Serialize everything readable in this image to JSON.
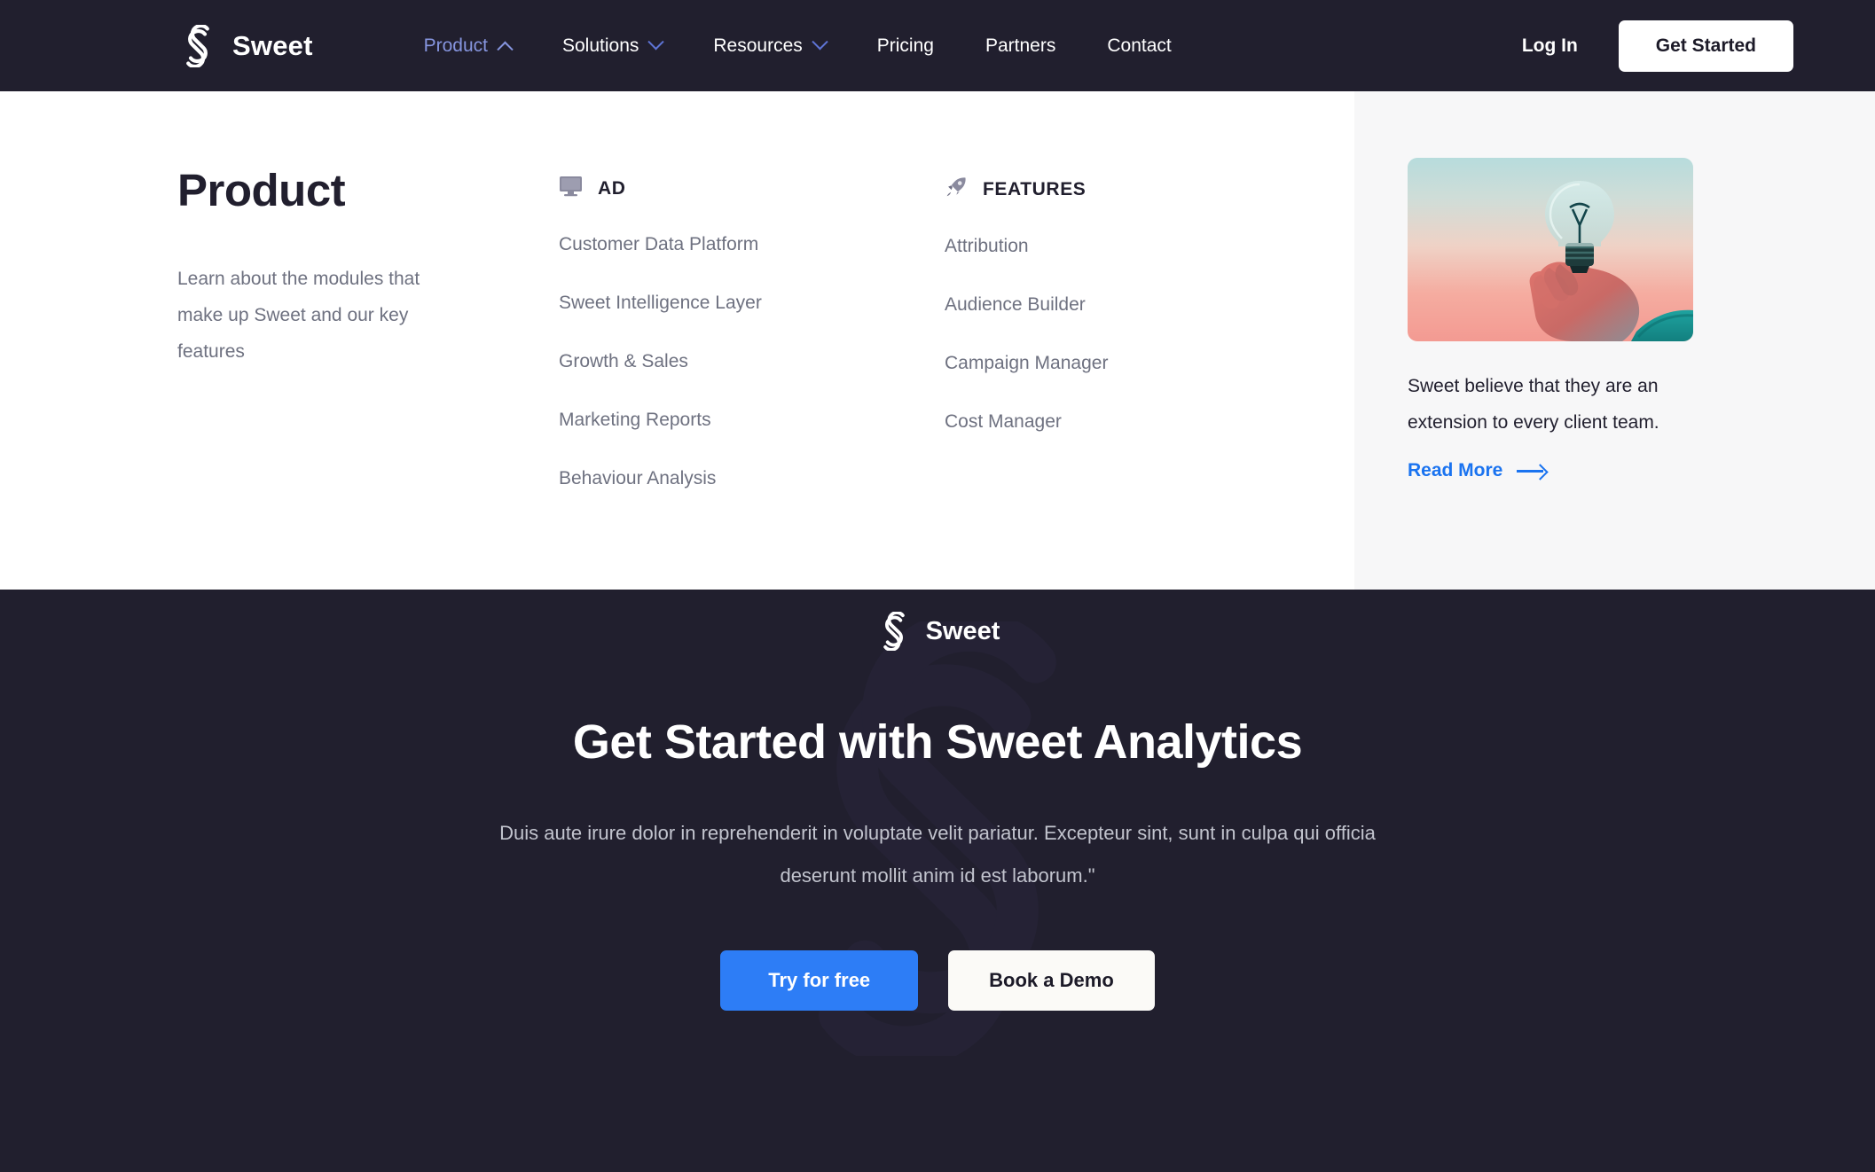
{
  "brand": {
    "name": "Sweet",
    "logo_icon": "sweet-s-logo-icon"
  },
  "navbar": {
    "items": [
      {
        "label": "Product",
        "icon": "chevron-up-icon",
        "active": true
      },
      {
        "label": "Solutions",
        "icon": "chevron-down-icon",
        "active": false
      },
      {
        "label": "Resources",
        "icon": "chevron-down-icon",
        "active": false
      },
      {
        "label": "Pricing",
        "icon": "",
        "active": false
      },
      {
        "label": "Partners",
        "icon": "",
        "active": false
      },
      {
        "label": "Contact",
        "icon": "",
        "active": false
      }
    ],
    "login_label": "Log In",
    "get_started_label": "Get Started",
    "active_link_color": "#8695DF",
    "background_color": "#211F2E"
  },
  "mega_menu": {
    "title": "Product",
    "description": "Learn about the modules that make up Sweet and our key features",
    "columns": [
      {
        "heading": "AD",
        "icon": "monitor-icon",
        "links": [
          "Customer Data Platform",
          "Sweet Intelligence Layer",
          "Growth & Sales",
          "Marketing Reports",
          "Behaviour Analysis"
        ]
      },
      {
        "heading": "FEATURES",
        "icon": "rocket-icon",
        "links": [
          "Attribution",
          "Audience Builder",
          "Campaign Manager",
          "Cost Manager"
        ]
      }
    ],
    "promo": {
      "image_alt": "hand-holding-lightbulb-image",
      "text": "Sweet believe that they are an extension to every client team.",
      "link_label": "Read More",
      "link_icon": "arrow-right-icon",
      "link_color": "#1A73F0"
    }
  },
  "cta": {
    "brand_name": "Sweet",
    "heading": "Get Started with Sweet Analytics",
    "paragraph": "Duis aute irure dolor in reprehenderit in voluptate velit pariatur. Excepteur sint, sunt in culpa qui officia deserunt mollit anim id est laborum.\"",
    "primary_label": "Try for free",
    "secondary_label": "Book a Demo",
    "primary_color": "#2D7DF6",
    "background_color": "#211F2E"
  }
}
